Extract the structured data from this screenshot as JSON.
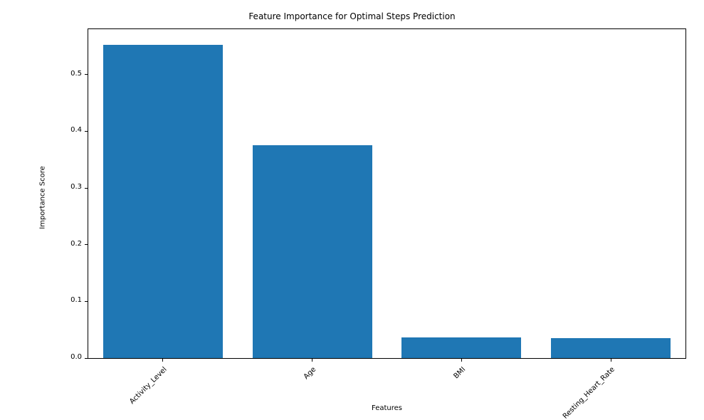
{
  "chart_data": {
    "type": "bar",
    "title": "Feature Importance for Optimal Steps Prediction",
    "xlabel": "Features",
    "ylabel": "Importance Score",
    "categories": [
      "Activity_Level",
      "Age",
      "BMI",
      "Resting_Heart_Rate"
    ],
    "values": [
      0.553,
      0.375,
      0.037,
      0.035
    ],
    "y_ticks": [
      0.0,
      0.1,
      0.2,
      0.3,
      0.4,
      0.5
    ],
    "y_tick_labels": [
      "0.0",
      "0.1",
      "0.2",
      "0.3",
      "0.4",
      "0.5"
    ],
    "ylim": [
      0,
      0.58
    ],
    "bar_color": "#1f77b4",
    "tick_rotation_deg": 45
  }
}
